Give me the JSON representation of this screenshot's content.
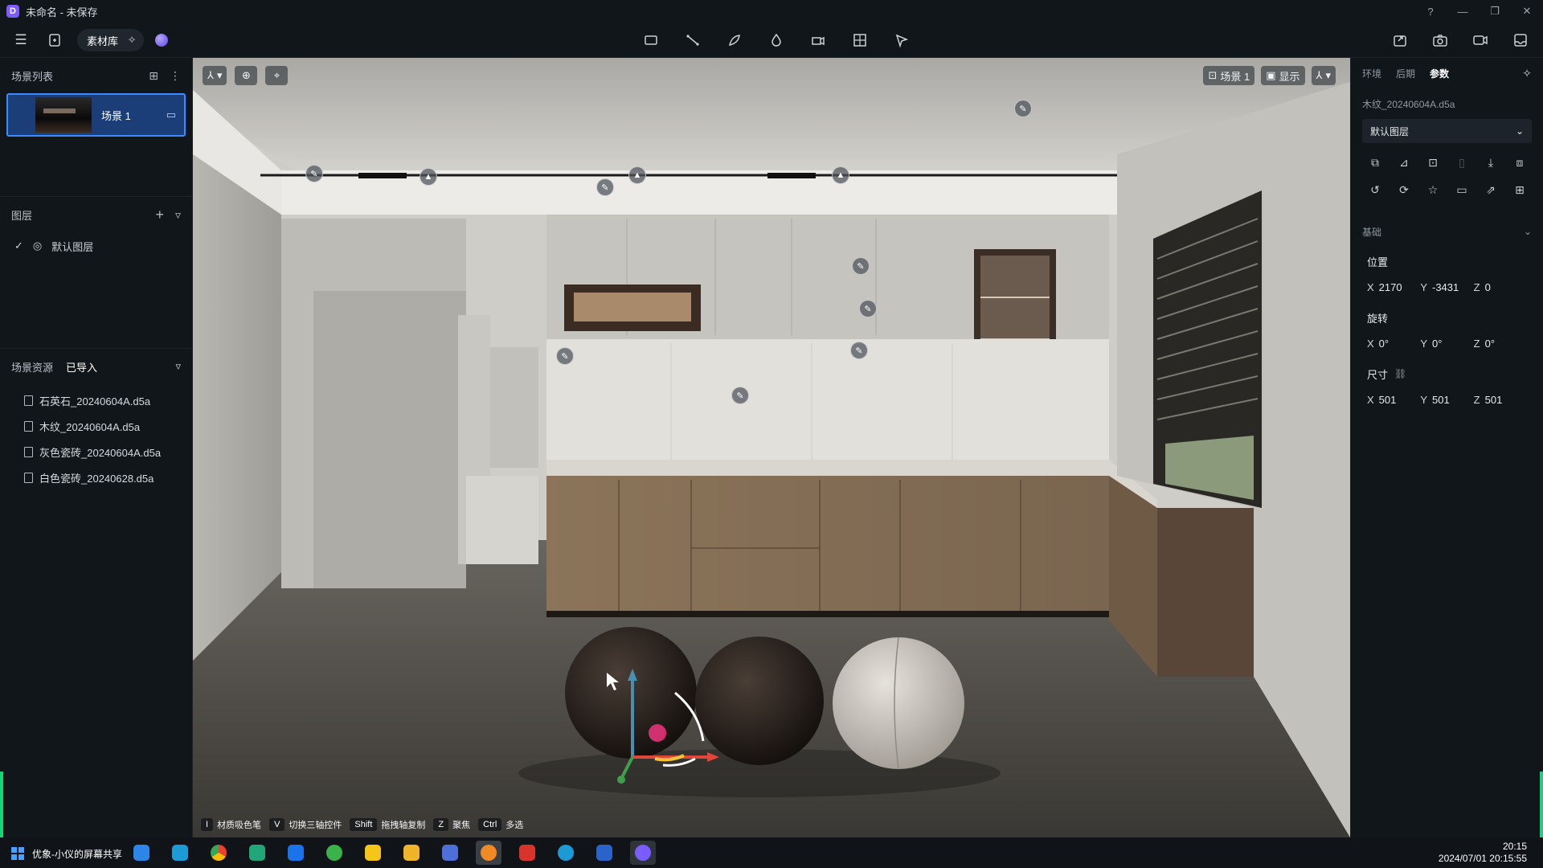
{
  "window": {
    "title": "未命名 - 未保存",
    "logo": "D",
    "controls": [
      "?",
      "—",
      "❐",
      "✕"
    ]
  },
  "toolbar": {
    "menu_icon": "menu-icon",
    "library_label": "素材库",
    "center_tools": [
      "rectangle-tool-icon",
      "line-tool-icon",
      "pen-tool-icon",
      "drop-tool-icon",
      "camera-rig-icon",
      "grid-tool-icon",
      "pointer-flag-icon"
    ],
    "right_tools": [
      "share-icon",
      "camera-icon",
      "video-icon",
      "export-icon"
    ]
  },
  "left_panel": {
    "scene_list_title": "场景列表",
    "scenes": [
      {
        "name": "场景 1"
      }
    ],
    "layers_title": "图层",
    "layers": [
      {
        "name": "默认图层",
        "checked": true
      }
    ],
    "assets_title": "场景资源",
    "assets_filter": "已导入",
    "assets": [
      {
        "name": "石英石_20240604A.d5a"
      },
      {
        "name": "木纹_20240604A.d5a"
      },
      {
        "name": "灰色瓷砖_20240604A.d5a"
      },
      {
        "name": "白色瓷砖_20240628.d5a"
      }
    ]
  },
  "viewport": {
    "scene_chip": "场景 1",
    "display_chip": "显示",
    "hints": [
      {
        "key": "I",
        "label": "材质吸色笔"
      },
      {
        "key": "V",
        "label": "切换三轴控件"
      },
      {
        "key": "Shift",
        "label": "拖拽轴复制"
      },
      {
        "key": "Z",
        "label": "聚焦"
      },
      {
        "key": "Ctrl",
        "label": "多选"
      }
    ]
  },
  "right_panel": {
    "tabs": [
      "环境",
      "后期",
      "参数"
    ],
    "active_tab": "参数",
    "file_name": "木纹_20240604A.d5a",
    "layer_select": "默认图层",
    "section_title": "基础",
    "position_label": "位置",
    "position": {
      "x": "2170",
      "y": "-3431",
      "z": "0"
    },
    "rotation_label": "旋转",
    "rotation": {
      "x": "0°",
      "y": "0°",
      "z": "0°"
    },
    "size_label": "尺寸",
    "size": {
      "x": "501",
      "y": "501",
      "z": "501"
    }
  },
  "taskbar": {
    "share_text": "优象-小仪的屏幕共享",
    "time": "20:15",
    "datetime": "2024/07/01 20:15:55"
  },
  "colors": {
    "accent_blue": "#3b8cff",
    "accent_green": "#12d67b",
    "panel_bg": "#11161b"
  }
}
